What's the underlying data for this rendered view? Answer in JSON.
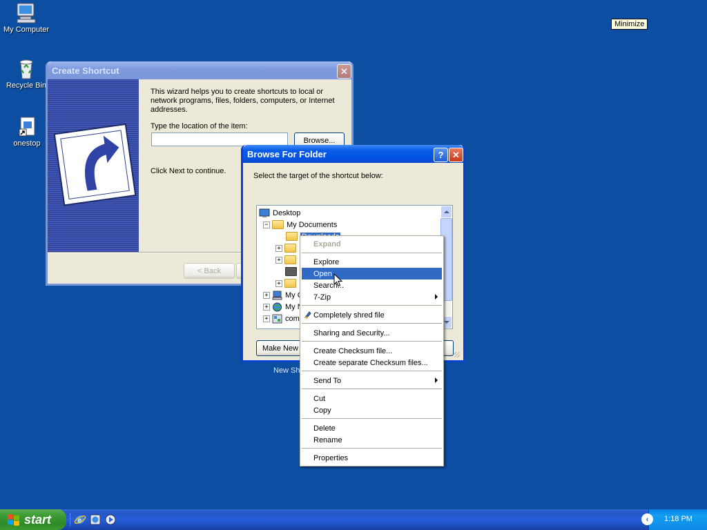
{
  "desktop": {
    "icons": [
      {
        "label": "My Computer",
        "icon": "my-computer-icon"
      },
      {
        "label": "Recycle Bin",
        "icon": "recycle-bin-icon"
      },
      {
        "label": "onestop",
        "icon": "shortcut-icon"
      }
    ],
    "tooltip": "Minimize",
    "background_color": "#0b4ea2"
  },
  "create_shortcut": {
    "title": "Create Shortcut",
    "intro": "This wizard helps you to create shortcuts to local or network programs, files, folders, computers, or Internet addresses.",
    "location_label": "Type the location of the item:",
    "location_value": "",
    "browse_label": "Browse...",
    "next_hint": "Click Next to continue.",
    "back_label": "< Back"
  },
  "browse_folder": {
    "title": "Browse For Folder",
    "prompt": "Select the target of the shortcut below:",
    "tree": [
      {
        "label": "Desktop"
      },
      {
        "label": "My Documents"
      },
      {
        "label": "Downloads",
        "selected": true
      },
      {
        "label": "My C"
      },
      {
        "label": "My N"
      },
      {
        "label": "com"
      }
    ],
    "make_new_folder": "Make New F",
    "below_text": "New Sh"
  },
  "context_menu": {
    "items": {
      "expand": "Expand",
      "explore": "Explore",
      "open": "Open",
      "search": "Search...",
      "zip": "7-Zip",
      "shred": "Completely shred file",
      "sharing": "Sharing and Security...",
      "checksum": "Create Checksum file...",
      "checksum_sep": "Create separate Checksum files...",
      "send_to": "Send To",
      "cut": "Cut",
      "copy": "Copy",
      "delete": "Delete",
      "rename": "Rename",
      "properties": "Properties"
    },
    "highlighted": "Open",
    "highlight_color": "#316ac5"
  },
  "taskbar": {
    "start_label": "start",
    "clock": "1:18 PM",
    "quick_launch": [
      "internet-explorer-icon",
      "ie-alt-icon",
      "media-player-icon"
    ]
  }
}
